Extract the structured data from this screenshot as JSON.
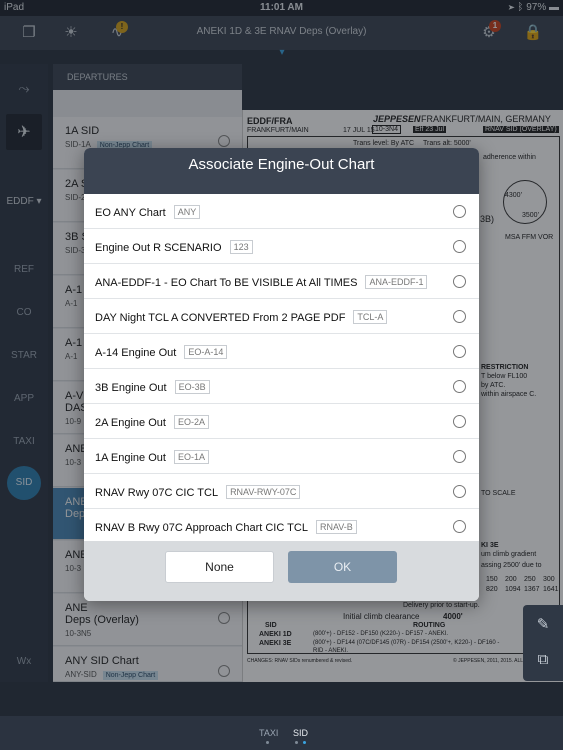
{
  "status": {
    "carrier": "iPad",
    "time": "11:01 AM",
    "battery": "97%"
  },
  "toolbar": {
    "title": "ANEKI 1D & 3E RNAV Deps (Overlay)",
    "settings_badge": "1",
    "warn_badge": "!"
  },
  "rail": {
    "airport": "EDDF ▾",
    "items": [
      "REF",
      "CO",
      "STAR",
      "APP",
      "TAXI",
      "SID",
      "Wx"
    ]
  },
  "list": {
    "header": "DEPARTURES",
    "rows": [
      {
        "title": "1A SID",
        "sub": "SID-1A",
        "tag": "Non-Jepp Chart"
      },
      {
        "title": "2A S",
        "sub": "SID-2",
        "tag": ""
      },
      {
        "title": "3B S",
        "sub": "SID-3",
        "tag": ""
      },
      {
        "title": "A-1",
        "sub": "A-1",
        "tag": ""
      },
      {
        "title": "A-1",
        "sub": "A-1",
        "tag": ""
      },
      {
        "title": "A-V",
        "sub": "DAS",
        "tag": ""
      },
      {
        "title": "10-9",
        "sub": "",
        "tag": ""
      },
      {
        "title": "ANE",
        "sub": "10-3",
        "tag": ""
      },
      {
        "title": "ANE",
        "sub": "Dep",
        "tag": ""
      },
      {
        "title": "ANE",
        "sub": "10-3",
        "tag": ""
      },
      {
        "title": "ANE",
        "sub": "Deps (Overlay)",
        "tag": ""
      },
      {
        "title": "ANY SID Chart",
        "sub": "ANY-SID",
        "tag": "Non-Jepp Chart"
      }
    ],
    "row_note": "10-3N5"
  },
  "chart": {
    "airport": "EDDF/FRA",
    "city": "FRANKFURT/MAIN",
    "brand": "JEPPESEN",
    "location": "FRANKFURT/MAIN, GERMANY",
    "date": "17 JUL 15",
    "chart_no": "10-3N4",
    "eff": "Eff 23 Jul",
    "type": "RNAV SID (OVERLAY)",
    "trans_level": "Trans level: By ATC",
    "trans_alt": "Trans alt: 5000'",
    "adherence": "adherence within",
    "three_b": "3B)",
    "msa": "MSA FFM VOR",
    "msa_a": "4300'",
    "msa_b": "3500'",
    "restriction": "RESTRICTION",
    "restr_1": "T below FL100",
    "restr_2": "by ATC.",
    "restr_3": "within airspace C.",
    "to_scale": "TO SCALE",
    "frankfurt": "FRANKFURT",
    "aneki3e": "KI 3E",
    "climb": "um climb gradient",
    "passing": "assing 2500' due to",
    "grad_vals": [
      "150",
      "200",
      "250",
      "300"
    ],
    "grad_vals2": [
      "820",
      "1094",
      "1367",
      "1641"
    ],
    "delivery": "Delivery prior to start-up.",
    "initial_climb": "Initial climb clearance",
    "initial_alt": "4000'",
    "sid_col": "SID",
    "routing_col": "ROUTING",
    "r1_sid": "ANEKI 1D",
    "r1_route": "(800'+) - DF152 - DF150 (K220-) - DF157 - ANEKI.",
    "r2_sid": "ANEKI 3E",
    "r2_route": "(800'+) - DF144 (07C/DF145 (07R) - DF154 (2500'+, K220-) - DF160 -",
    "r2_route2": "RID - ANEKI.",
    "changes": "CHANGES: RNAV SIDs renumbered & revised.",
    "copyright": "© JEPPESEN, 2011, 2015. ALL RIGHTS"
  },
  "modal": {
    "title": "Associate Engine-Out Chart",
    "options": [
      {
        "label": "EO ANY Chart",
        "code": "ANY"
      },
      {
        "label": "Engine Out R SCENARIO",
        "code": "123"
      },
      {
        "label": "ANA-EDDF-1 - EO Chart To BE VISIBLE At All TIMES",
        "code": "ANA-EDDF-1"
      },
      {
        "label": "DAY Night TCL A CONVERTED From 2 PAGE PDF",
        "code": "TCL-A"
      },
      {
        "label": "A-14 Engine Out",
        "code": "EO-A-14"
      },
      {
        "label": "3B Engine Out",
        "code": "EO-3B"
      },
      {
        "label": "2A Engine Out",
        "code": "EO-2A"
      },
      {
        "label": "1A Engine Out",
        "code": "EO-1A"
      },
      {
        "label": "RNAV Rwy 07C CIC TCL",
        "code": "RNAV-RWY-07C"
      },
      {
        "label": "RNAV B Rwy 07C Approach Chart CIC TCL",
        "code": "RNAV-B"
      }
    ],
    "none_label": "None",
    "ok_label": "OK"
  },
  "tabbar": {
    "tabs": [
      "TAXI",
      "SID"
    ],
    "active": "SID"
  },
  "colors": {
    "accent": "#3aa3e0",
    "toolbar": "#3b4452",
    "sid_selected": "#2c7fb0",
    "ok_button": "#7e94a8"
  },
  "icons": {
    "toolbar": [
      "documents-icon",
      "brightness-icon",
      "notification-warning-icon",
      "settings-gear-icon",
      "lock-icon"
    ],
    "tools": [
      "pen-icon",
      "clip-icon"
    ]
  }
}
